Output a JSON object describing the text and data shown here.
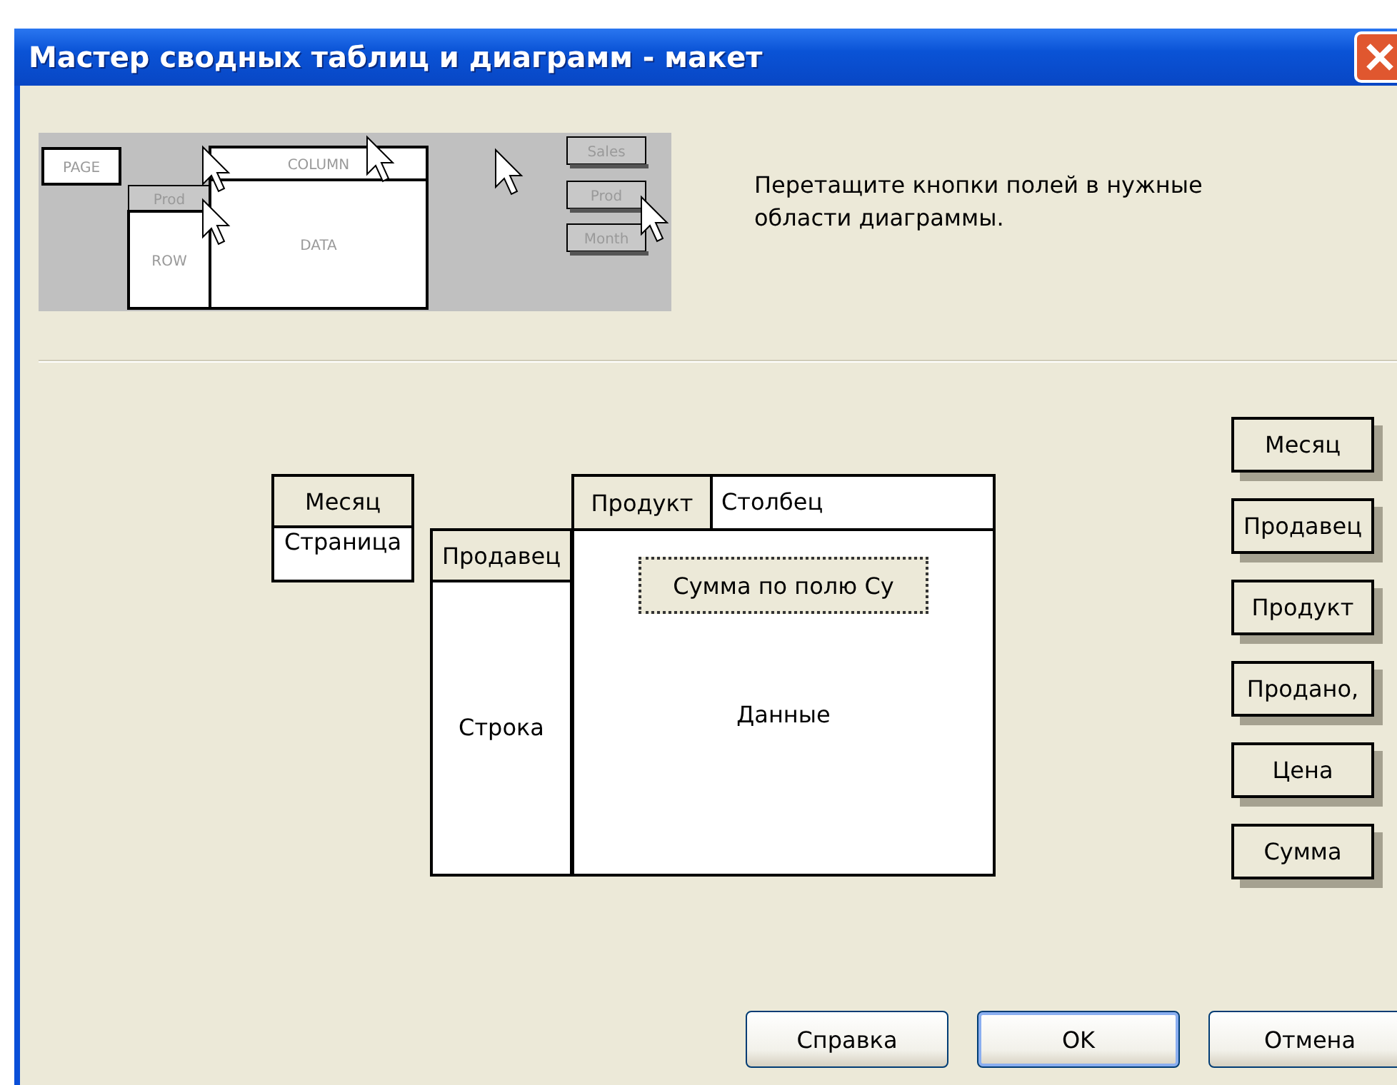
{
  "window": {
    "title": "Мастер сводных таблиц и диаграмм - макет"
  },
  "preview": {
    "labels": [
      {
        "kind": "area",
        "text": "PAGE"
      },
      {
        "kind": "field",
        "text": "Prod"
      },
      {
        "kind": "area",
        "text": "COLUMN"
      },
      {
        "kind": "area",
        "text": "ROW"
      },
      {
        "kind": "area",
        "text": "DATA"
      },
      {
        "kind": "field",
        "text": "Sales"
      },
      {
        "kind": "field",
        "text": "Prod"
      },
      {
        "kind": "field",
        "text": "Month"
      }
    ]
  },
  "instruction": "Перетащите кнопки полей в нужные области диаграммы.",
  "layout": {
    "page": {
      "label": "Страница",
      "fields": [
        {
          "label": "Месяц",
          "focused": false
        }
      ]
    },
    "row": {
      "label": "Строка",
      "fields": [
        {
          "label": "Продавец",
          "focused": false
        }
      ]
    },
    "column": {
      "label": "Столбец",
      "fields": [
        {
          "label": "Продукт",
          "focused": false
        }
      ]
    },
    "data": {
      "label": "Данные",
      "fields": [
        {
          "label": "Сумма по полю Су",
          "focused": true
        }
      ]
    }
  },
  "field_buttons": [
    "Месяц",
    "Продавец",
    "Продукт",
    "Продано,",
    "Цена",
    "Сумма"
  ],
  "buttons": [
    {
      "label": "Справка",
      "default": false
    },
    {
      "label": "OK",
      "default": true
    },
    {
      "label": "Отмена",
      "default": false
    }
  ]
}
